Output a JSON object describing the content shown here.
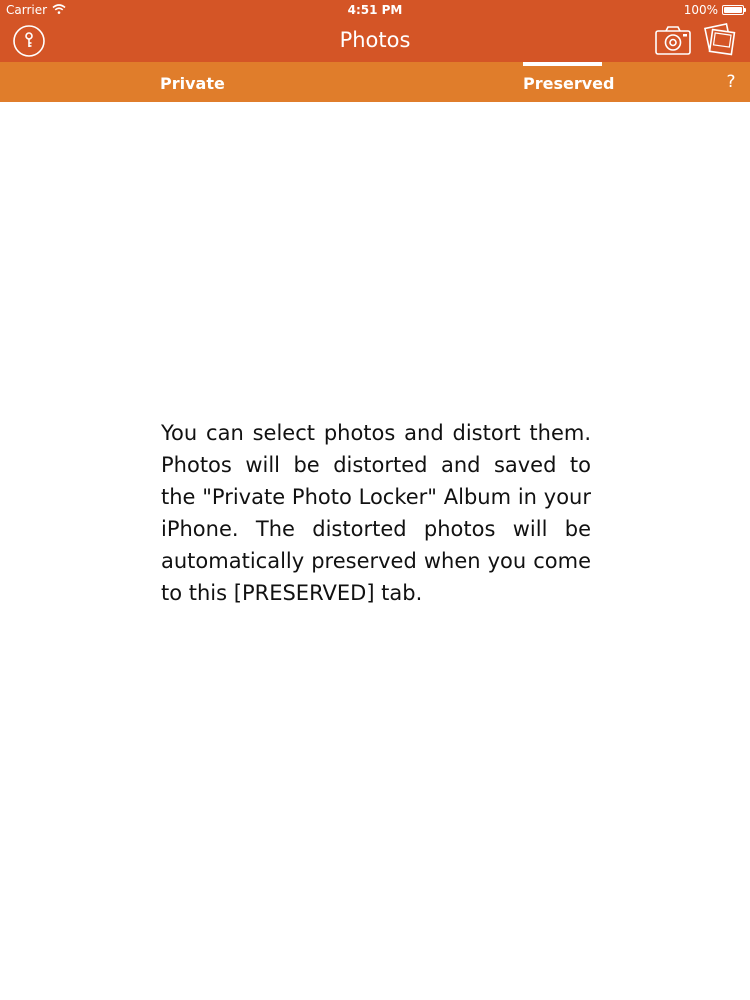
{
  "status_bar": {
    "carrier": "Carrier",
    "time": "4:51 PM",
    "battery": "100%",
    "battery_level": 1.0
  },
  "nav": {
    "title": "Photos",
    "left_icon": "lock-icon",
    "camera_icon": "camera-icon",
    "album_icon": "photo-stack-icon"
  },
  "tabs": [
    {
      "label": "Private",
      "selected": false
    },
    {
      "label": "Preserved",
      "selected": true
    }
  ],
  "help": {
    "label": "?"
  },
  "message": {
    "text": "You can select photos and distort them. Photos will be distorted and saved to the \"Private Photo Locker\" Album in your iPhone. The distorted photos will be automatically preserved when you come to this [PRESERVED] tab."
  },
  "colors": {
    "nav_bar": "#d45526",
    "tab_bar": "#e07d2b",
    "text": "#111111"
  }
}
